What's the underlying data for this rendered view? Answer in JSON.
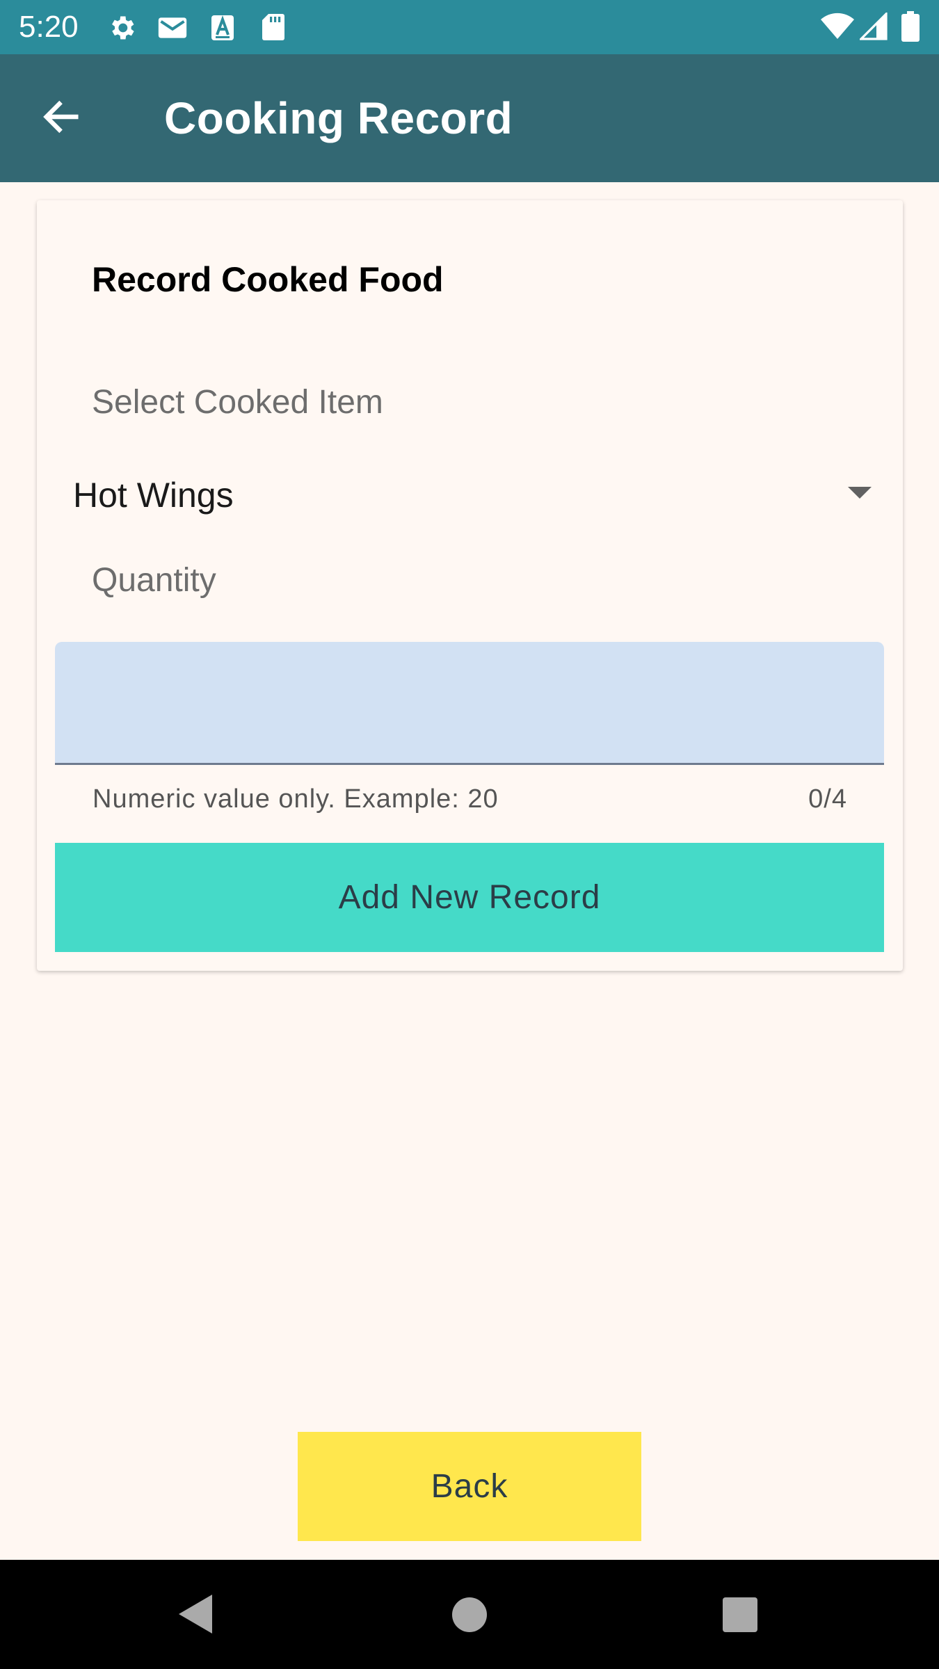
{
  "status_bar": {
    "time": "5:20",
    "icons": [
      "gear-icon",
      "gmail-icon",
      "a-badge-icon",
      "sd-card-icon",
      "wifi-icon",
      "signal-icon",
      "battery-icon"
    ]
  },
  "app_bar": {
    "title": "Cooking Record",
    "back_icon": "arrow-back-icon"
  },
  "form": {
    "title": "Record Cooked Food",
    "select_label": "Select Cooked Item",
    "selected_item": "Hot Wings",
    "quantity_label": "Quantity",
    "quantity_value": "",
    "helper_text": "Numeric value only. Example: 20",
    "counter": "0/4",
    "add_button": "Add New Record"
  },
  "back_button": "Back",
  "colors": {
    "status_bar": "#2b8c9b",
    "app_bar": "#336873",
    "background": "#fff7f2",
    "add_button": "#45dac8",
    "back_button": "#ffe74d",
    "input_fill": "#d2e1f3"
  }
}
